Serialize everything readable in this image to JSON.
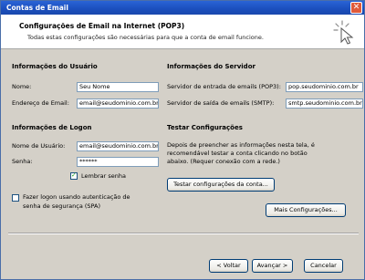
{
  "window": {
    "title": "Contas de Email",
    "close_symbol": "✕"
  },
  "header": {
    "title": "Configurações de Email na Internet (POP3)",
    "subtitle": "Todas estas configurações são necessárias para que a conta de email funcione.",
    "icon": "cursor-sparkle-icon"
  },
  "user_info": {
    "title": "Informações do Usuário",
    "name_label": "Nome:",
    "name_value": "Seu Nome",
    "email_label": "Endereço de Email:",
    "email_value": "email@seudominio.com.br"
  },
  "server_info": {
    "title": "Informações do Servidor",
    "incoming_label": "Servidor de entrada de emails (POP3):",
    "incoming_value": "pop.seudominio.com.br",
    "outgoing_label": "Servidor de saída de emails (SMTP):",
    "outgoing_value": "smtp.seudominio.com.br"
  },
  "logon_info": {
    "title": "Informações de Logon",
    "username_label": "Nome de Usuário:",
    "username_value": "email@seudominio.com.br",
    "password_label": "Senha:",
    "password_value": "******",
    "remember_label": "Lembrar senha",
    "remember_checked": true,
    "spa_label_line1": "Fazer logon usando autenticação de",
    "spa_label_line2": "senha de segurança (SPA)",
    "spa_checked": false
  },
  "test_settings": {
    "title": "Testar Configurações",
    "desc_line1": "Depois de preencher as informações nesta tela, é",
    "desc_line2": "recomendável testar a conta clicando no botão",
    "desc_line3": "abaixo. (Requer conexão com a rede.)",
    "test_button": "Testar configurações da conta...",
    "more_button": "Mais Configurações..."
  },
  "footer": {
    "back_button": "< Voltar",
    "next_button": "Avançar >",
    "cancel_button": "Cancelar"
  }
}
